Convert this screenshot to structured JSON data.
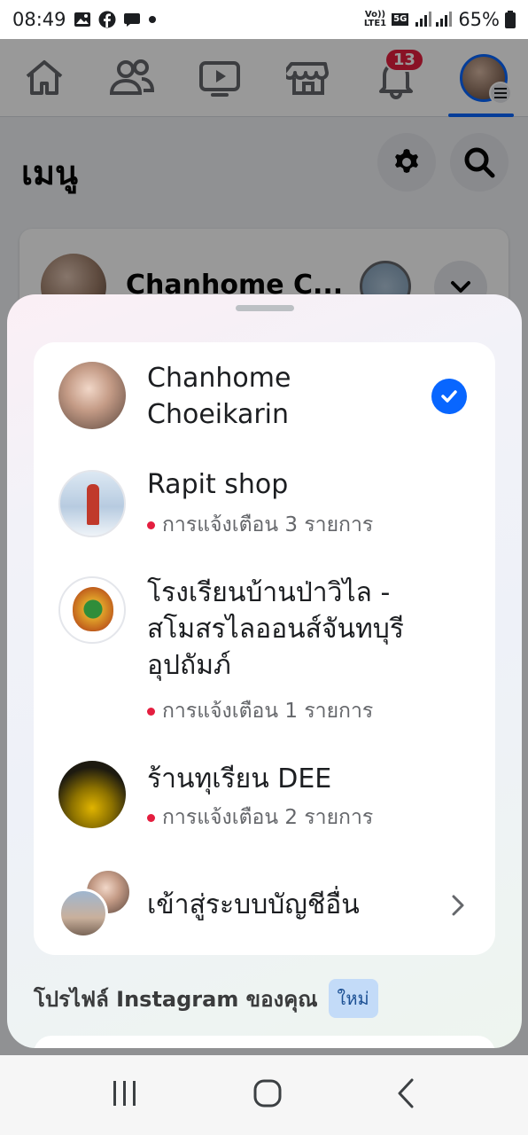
{
  "status_bar": {
    "time": "08:49",
    "lte_top": "Vo))",
    "lte_bottom": "LTE1",
    "net_5g": "5G",
    "battery": "65%",
    "icons": [
      "gallery-icon",
      "facebook-icon",
      "chat-icon",
      "dot-icon",
      "signal-icon",
      "battery-icon"
    ]
  },
  "top_nav": {
    "items": [
      "home-icon",
      "friends-icon",
      "video-icon",
      "marketplace-icon",
      "notifications-icon",
      "profile-menu-icon"
    ],
    "notification_count": "13"
  },
  "menu": {
    "title": "เมนู",
    "profile_name": "Chanhome C..."
  },
  "sheet": {
    "accounts": [
      {
        "name": "Chanhome Choeikarin",
        "selected": true
      },
      {
        "name": "Rapit shop",
        "notification": "การแจ้งเตือน 3 รายการ"
      },
      {
        "name": "โรงเรียนบ้านป่าวิไล - สโมสรไลออนส์จันทบุรี อุปถัมภ์",
        "notification": "การแจ้งเตือน 1 รายการ"
      },
      {
        "name": "ร้านทุเรียน DEE",
        "notification": "การแจ้งเตือน 2 รายการ"
      }
    ],
    "other_account": "เข้าสู่ระบบบัญชีอื่น",
    "instagram_label": "โปรไฟล์ Instagram ของคุณ",
    "new_badge": "ใหม่"
  },
  "colors": {
    "accent": "#0866ff",
    "badge_red": "#e41e3f"
  }
}
